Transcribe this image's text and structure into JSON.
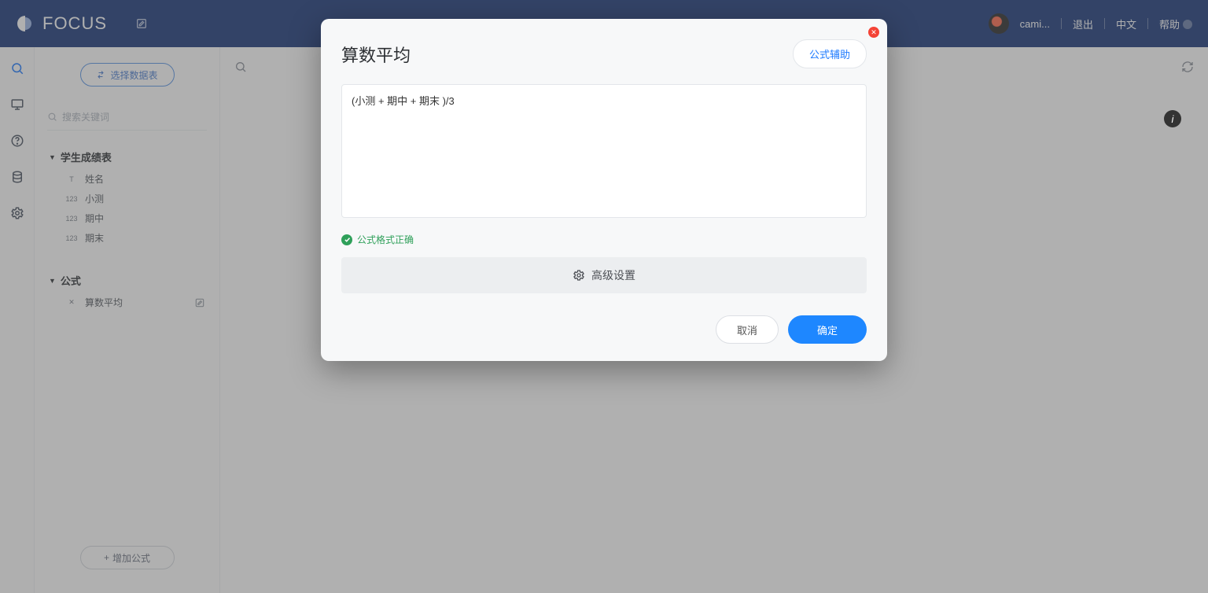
{
  "header": {
    "brand": "FOCUS",
    "user": "cami...",
    "logout": "退出",
    "lang": "中文",
    "help": "帮助"
  },
  "side": {
    "select_table": "选择数据表",
    "search_placeholder": "搜索关键词",
    "table_name": "学生成绩表",
    "columns": {
      "name": "姓名",
      "quiz": "小测",
      "midterm": "期中",
      "final": "期末"
    },
    "formula_section": "公式",
    "formula_item": "算数平均",
    "add_formula": "增加公式"
  },
  "modal": {
    "title": "算数平均",
    "assist": "公式辅助",
    "formula_value": "(小测 + 期中 + 期末 )/3",
    "status": "公式格式正确",
    "advanced": "高级设置",
    "cancel": "取消",
    "ok": "确定"
  }
}
